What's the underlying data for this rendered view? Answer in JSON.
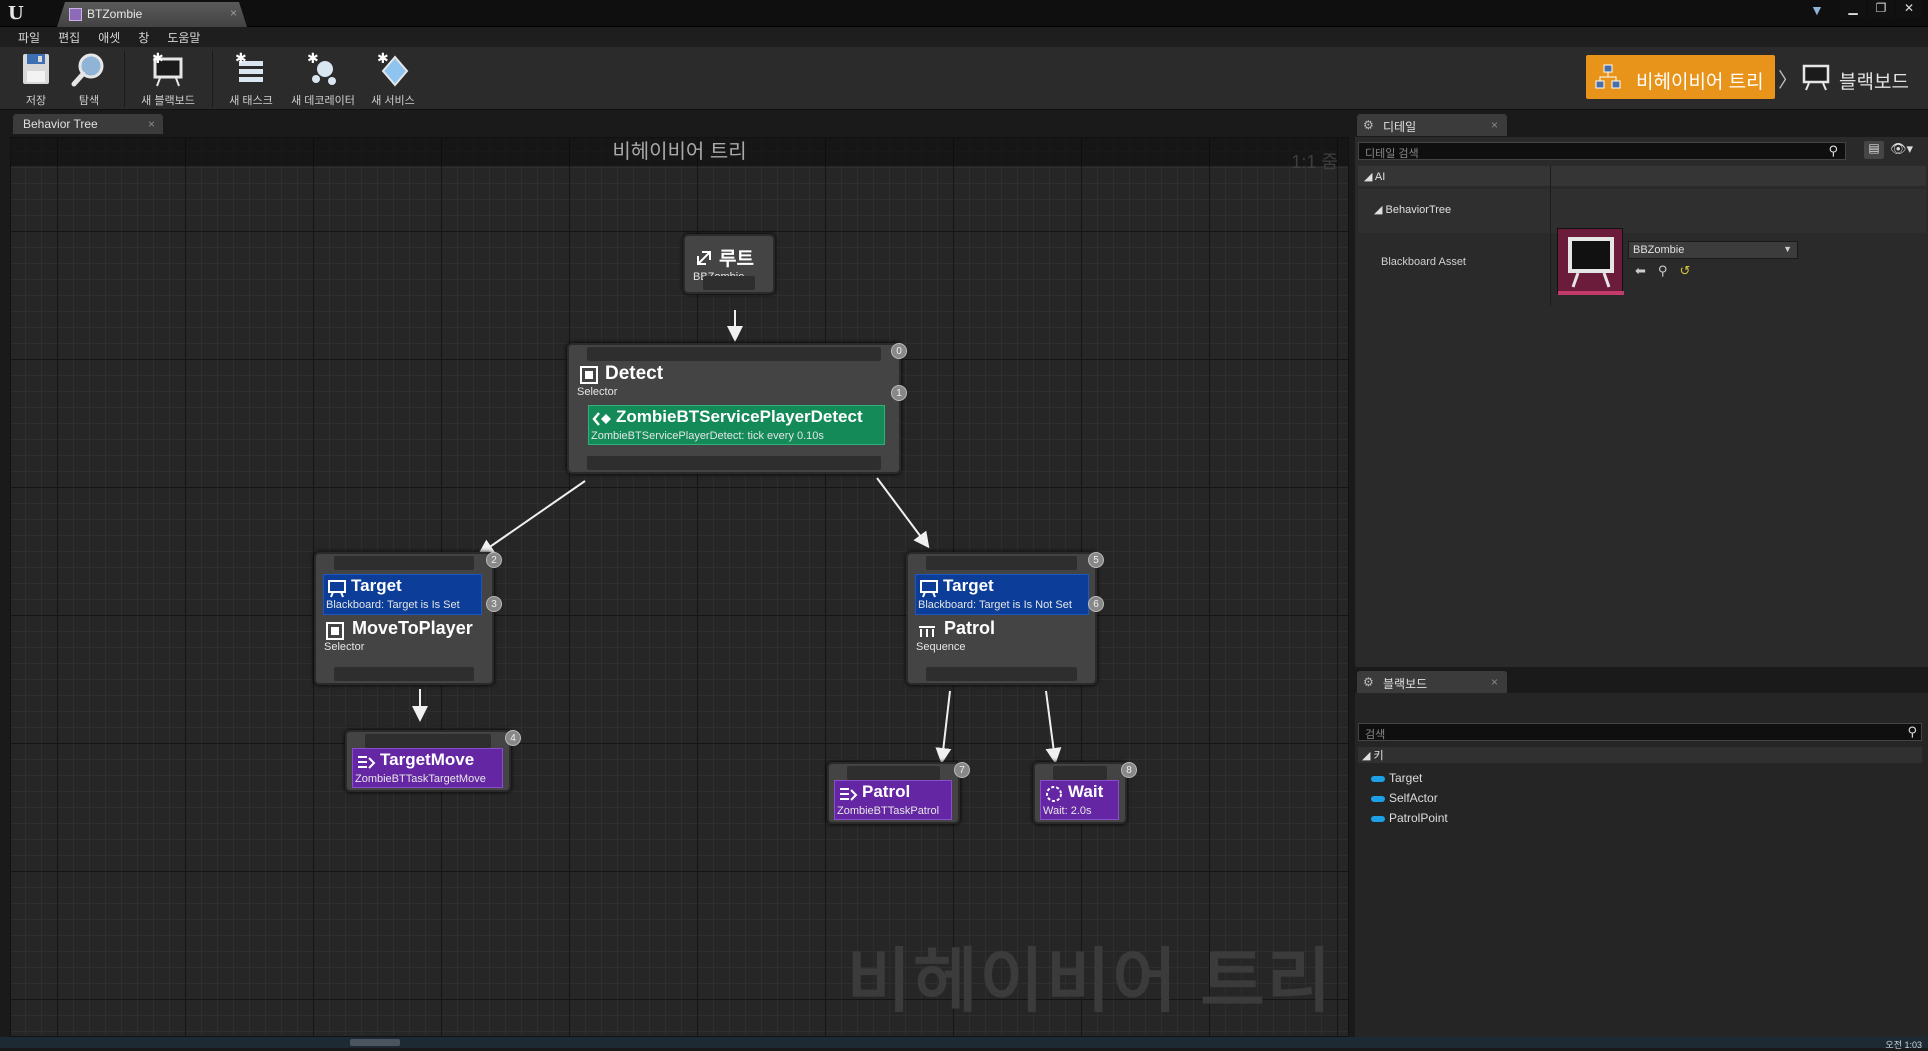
{
  "window": {
    "tab_title": "BTZombie",
    "tab_close": "×",
    "controls": [
      "▁",
      "❐",
      "✕"
    ]
  },
  "menu": [
    "파일",
    "편집",
    "애셋",
    "창",
    "도움말"
  ],
  "toolbar": {
    "save": "저장",
    "browse": "탐색",
    "new_blackboard": "새 블랙보드",
    "new_task": "새 태스크",
    "new_decorator": "새 데코레이터",
    "new_service": "새 서비스"
  },
  "modes": {
    "behavior_tree": "비헤이비어 트리",
    "separator": "〉",
    "blackboard": "블랙보드",
    "active_color": "#e8941a"
  },
  "graph": {
    "tab_label": "Behavior Tree",
    "tab_close": "×",
    "title": "비헤이비어 트리",
    "zoom": "1:1 줌",
    "watermark": "비헤이비어 트리",
    "nodes": {
      "root": {
        "title": "루트",
        "subtitle": "BBZombie"
      },
      "detect": {
        "title": "Detect",
        "subtitle": "Selector",
        "index": "0",
        "service_index": "1",
        "service_title": "ZombieBTServicePlayerDetect",
        "service_subtitle": "ZombieBTServicePlayerDetect: tick every 0.10s"
      },
      "move_to_player": {
        "deco_title": "Target",
        "deco_subtitle": "Blackboard: Target is Is Set",
        "deco_index": "2",
        "title": "MoveToPlayer",
        "subtitle": "Selector",
        "index": "3"
      },
      "patrol_seq": {
        "deco_title": "Target",
        "deco_subtitle": "Blackboard: Target is Is Not Set",
        "deco_index": "5",
        "title": "Patrol",
        "subtitle": "Sequence",
        "index": "6"
      },
      "target_move": {
        "title": "TargetMove",
        "subtitle": "ZombieBTTaskTargetMove",
        "index": "4"
      },
      "patrol_task": {
        "title": "Patrol",
        "subtitle": "ZombieBTTaskPatrol",
        "index": "7"
      },
      "wait": {
        "title": "Wait",
        "subtitle": "Wait: 2.0s",
        "index": "8"
      }
    },
    "colors": {
      "decorator": "#0b3d99",
      "service": "#138a58",
      "task": "#6426a3",
      "composite": "#444444"
    }
  },
  "details": {
    "tab_label": "디테일",
    "tab_close": "×",
    "search_placeholder": "디테일 검색",
    "category": "AI",
    "subcategory": "BehaviorTree",
    "property_label": "Blackboard Asset",
    "blackboard_asset": "BBZombie",
    "actions": [
      "⬅",
      "⚲",
      "↺"
    ]
  },
  "blackboard": {
    "tab_label": "블랙보드",
    "tab_close": "×",
    "search_placeholder": "검색",
    "keys_header": "키",
    "keys": [
      "Target",
      "SelfActor",
      "PatrolPoint"
    ]
  },
  "status": {
    "right_text": "오전 1:03"
  }
}
